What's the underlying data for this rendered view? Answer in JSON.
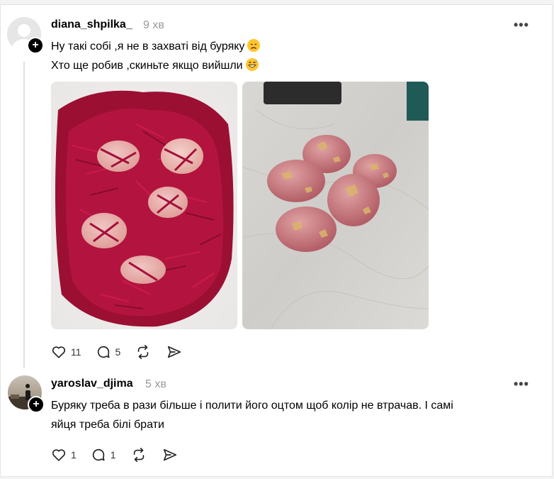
{
  "posts": [
    {
      "username": "diana_shpilka_",
      "time": "9 хв",
      "lines": [
        "Ну такі собі ,я не в захваті від буряку",
        "Хто ще робив ,скиньте якщо вийшли"
      ],
      "likes": "11",
      "replies": "5",
      "more": "•••"
    },
    {
      "username": "yaroslav_djima",
      "time": "5 хв",
      "lines": [
        "Буряку треба в рази більше і полити його оцтом щоб колір не втрачав. І самі",
        "яйця треба білі брати"
      ],
      "likes": "1",
      "replies": "1",
      "more": "•••"
    }
  ],
  "icons": {
    "plus": "+",
    "like": "heart-icon",
    "reply": "comment-icon",
    "repost": "repost-icon",
    "share": "share-icon"
  }
}
